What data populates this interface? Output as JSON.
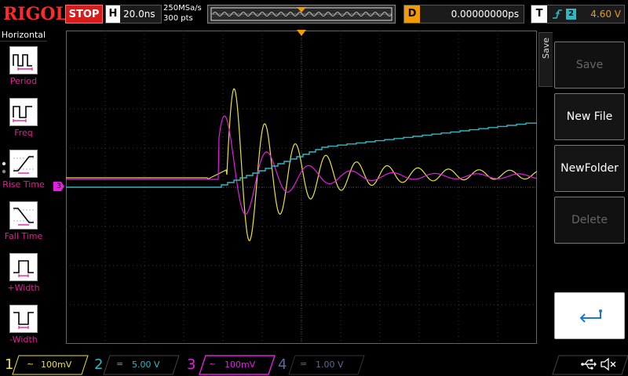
{
  "top_bar": {
    "logo": "RIGOL",
    "run_state": "STOP",
    "horizontal": {
      "letter": "H",
      "timebase": "20.0ns"
    },
    "sampling": {
      "rate": "250MSa/s",
      "points": "300 pts"
    },
    "delay": {
      "letter": "D",
      "value": "0.00000000ps"
    },
    "trigger": {
      "letter": "T",
      "source": "2",
      "level": "4.60 V"
    }
  },
  "left_menu": {
    "title": "Horizontal",
    "items": [
      {
        "label": "Period",
        "icon": "period-icon"
      },
      {
        "label": "Freq",
        "icon": "frequency-icon"
      },
      {
        "label": "Rise Time",
        "icon": "rise-time-icon"
      },
      {
        "label": "Fall Time",
        "icon": "fall-time-icon"
      },
      {
        "label": "+Width",
        "icon": "positive-width-icon"
      },
      {
        "label": "-Width",
        "icon": "negative-width-icon"
      }
    ]
  },
  "right_menu": {
    "tab": "Save",
    "keys": [
      {
        "label": "Save",
        "state": "disabled"
      },
      {
        "label": "New File",
        "state": "enabled"
      },
      {
        "label": "NewFolder",
        "state": "enabled"
      },
      {
        "label": "Delete",
        "state": "disabled"
      },
      {
        "label": "",
        "icon": "return-icon"
      }
    ]
  },
  "markers": {
    "ch3_ref": "3",
    "trigger_level_ref": "T",
    "trigger_pos_ref": "T"
  },
  "channels": [
    {
      "num": "1",
      "coupling": "~",
      "scale": "100mV",
      "color": "#e8e23c",
      "active": true
    },
    {
      "num": "2",
      "coupling": "=",
      "scale": "5.00 V",
      "color": "#2fb8c4",
      "active": true
    },
    {
      "num": "3",
      "coupling": "~",
      "scale": "100mV",
      "color": "#e31fe0",
      "active": true
    },
    {
      "num": "4",
      "coupling": "=",
      "scale": "1.00 V",
      "color": "#5a6aa0",
      "active": false
    }
  ],
  "status_icons": [
    "usb-icon",
    "speaker-muted-icon"
  ],
  "colors": {
    "logo": "#ff2a2a",
    "stop": "#d81c1c",
    "delay": "#f39a00",
    "ch1": "#e8e23c",
    "ch2": "#2fb8c4",
    "ch3": "#e31fe0",
    "ch4": "#5a6aa0",
    "grid": "#3a3a3a"
  }
}
